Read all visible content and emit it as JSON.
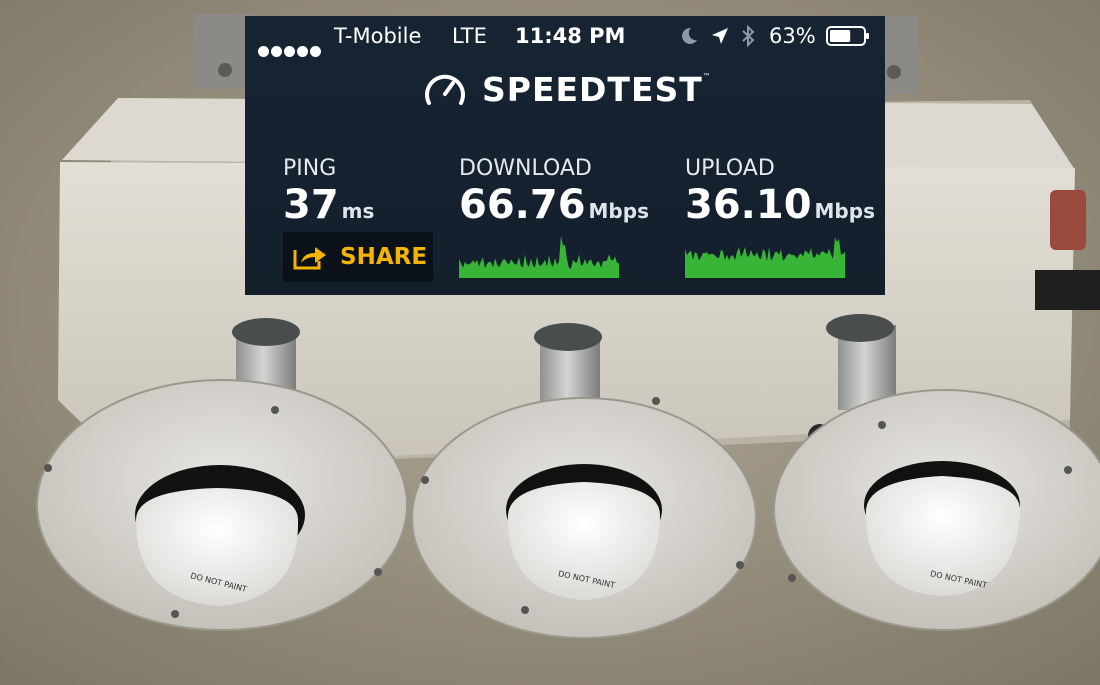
{
  "status_bar": {
    "signal_dots": 5,
    "carrier": "T-Mobile",
    "network": "LTE",
    "time": "11:48 PM",
    "battery_percent": "63%",
    "battery_level": 0.63,
    "icons": [
      "do-not-disturb-moon-icon",
      "location-arrow-icon",
      "bluetooth-icon",
      "battery-icon"
    ]
  },
  "app": {
    "logo_text": "SPEEDTEST",
    "trademark": "™"
  },
  "results": {
    "ping": {
      "label": "PING",
      "value": "37",
      "unit": "ms"
    },
    "download": {
      "label": "DOWNLOAD",
      "value": "66.76",
      "unit": "Mbps"
    },
    "upload": {
      "label": "UPLOAD",
      "value": "36.10",
      "unit": "Mbps"
    }
  },
  "share": {
    "label": "SHARE",
    "icon": "share-arrow-icon"
  },
  "colors": {
    "panel_bg": "#152130",
    "accent_yellow": "#f5b400",
    "graph_green": "#3ecf3a"
  },
  "background_photo": {
    "stamped_text": [
      "DO NOT PAINT",
      "DO NOT PAINT",
      "DO NOT PAINT"
    ]
  }
}
